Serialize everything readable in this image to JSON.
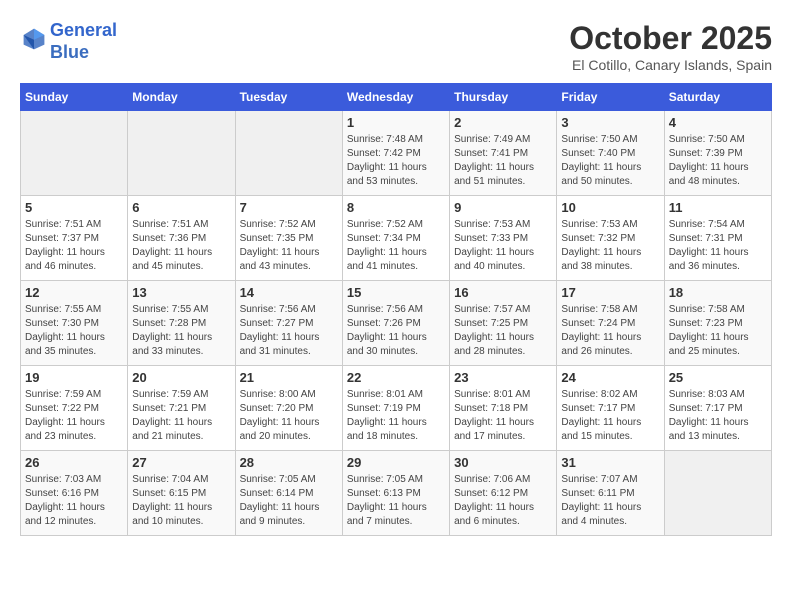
{
  "header": {
    "logo_line1": "General",
    "logo_line2": "Blue",
    "month": "October 2025",
    "location": "El Cotillo, Canary Islands, Spain"
  },
  "weekdays": [
    "Sunday",
    "Monday",
    "Tuesday",
    "Wednesday",
    "Thursday",
    "Friday",
    "Saturday"
  ],
  "weeks": [
    [
      {
        "day": "",
        "sunrise": "",
        "sunset": "",
        "daylight": ""
      },
      {
        "day": "",
        "sunrise": "",
        "sunset": "",
        "daylight": ""
      },
      {
        "day": "",
        "sunrise": "",
        "sunset": "",
        "daylight": ""
      },
      {
        "day": "1",
        "sunrise": "Sunrise: 7:48 AM",
        "sunset": "Sunset: 7:42 PM",
        "daylight": "Daylight: 11 hours and 53 minutes."
      },
      {
        "day": "2",
        "sunrise": "Sunrise: 7:49 AM",
        "sunset": "Sunset: 7:41 PM",
        "daylight": "Daylight: 11 hours and 51 minutes."
      },
      {
        "day": "3",
        "sunrise": "Sunrise: 7:50 AM",
        "sunset": "Sunset: 7:40 PM",
        "daylight": "Daylight: 11 hours and 50 minutes."
      },
      {
        "day": "4",
        "sunrise": "Sunrise: 7:50 AM",
        "sunset": "Sunset: 7:39 PM",
        "daylight": "Daylight: 11 hours and 48 minutes."
      }
    ],
    [
      {
        "day": "5",
        "sunrise": "Sunrise: 7:51 AM",
        "sunset": "Sunset: 7:37 PM",
        "daylight": "Daylight: 11 hours and 46 minutes."
      },
      {
        "day": "6",
        "sunrise": "Sunrise: 7:51 AM",
        "sunset": "Sunset: 7:36 PM",
        "daylight": "Daylight: 11 hours and 45 minutes."
      },
      {
        "day": "7",
        "sunrise": "Sunrise: 7:52 AM",
        "sunset": "Sunset: 7:35 PM",
        "daylight": "Daylight: 11 hours and 43 minutes."
      },
      {
        "day": "8",
        "sunrise": "Sunrise: 7:52 AM",
        "sunset": "Sunset: 7:34 PM",
        "daylight": "Daylight: 11 hours and 41 minutes."
      },
      {
        "day": "9",
        "sunrise": "Sunrise: 7:53 AM",
        "sunset": "Sunset: 7:33 PM",
        "daylight": "Daylight: 11 hours and 40 minutes."
      },
      {
        "day": "10",
        "sunrise": "Sunrise: 7:53 AM",
        "sunset": "Sunset: 7:32 PM",
        "daylight": "Daylight: 11 hours and 38 minutes."
      },
      {
        "day": "11",
        "sunrise": "Sunrise: 7:54 AM",
        "sunset": "Sunset: 7:31 PM",
        "daylight": "Daylight: 11 hours and 36 minutes."
      }
    ],
    [
      {
        "day": "12",
        "sunrise": "Sunrise: 7:55 AM",
        "sunset": "Sunset: 7:30 PM",
        "daylight": "Daylight: 11 hours and 35 minutes."
      },
      {
        "day": "13",
        "sunrise": "Sunrise: 7:55 AM",
        "sunset": "Sunset: 7:28 PM",
        "daylight": "Daylight: 11 hours and 33 minutes."
      },
      {
        "day": "14",
        "sunrise": "Sunrise: 7:56 AM",
        "sunset": "Sunset: 7:27 PM",
        "daylight": "Daylight: 11 hours and 31 minutes."
      },
      {
        "day": "15",
        "sunrise": "Sunrise: 7:56 AM",
        "sunset": "Sunset: 7:26 PM",
        "daylight": "Daylight: 11 hours and 30 minutes."
      },
      {
        "day": "16",
        "sunrise": "Sunrise: 7:57 AM",
        "sunset": "Sunset: 7:25 PM",
        "daylight": "Daylight: 11 hours and 28 minutes."
      },
      {
        "day": "17",
        "sunrise": "Sunrise: 7:58 AM",
        "sunset": "Sunset: 7:24 PM",
        "daylight": "Daylight: 11 hours and 26 minutes."
      },
      {
        "day": "18",
        "sunrise": "Sunrise: 7:58 AM",
        "sunset": "Sunset: 7:23 PM",
        "daylight": "Daylight: 11 hours and 25 minutes."
      }
    ],
    [
      {
        "day": "19",
        "sunrise": "Sunrise: 7:59 AM",
        "sunset": "Sunset: 7:22 PM",
        "daylight": "Daylight: 11 hours and 23 minutes."
      },
      {
        "day": "20",
        "sunrise": "Sunrise: 7:59 AM",
        "sunset": "Sunset: 7:21 PM",
        "daylight": "Daylight: 11 hours and 21 minutes."
      },
      {
        "day": "21",
        "sunrise": "Sunrise: 8:00 AM",
        "sunset": "Sunset: 7:20 PM",
        "daylight": "Daylight: 11 hours and 20 minutes."
      },
      {
        "day": "22",
        "sunrise": "Sunrise: 8:01 AM",
        "sunset": "Sunset: 7:19 PM",
        "daylight": "Daylight: 11 hours and 18 minutes."
      },
      {
        "day": "23",
        "sunrise": "Sunrise: 8:01 AM",
        "sunset": "Sunset: 7:18 PM",
        "daylight": "Daylight: 11 hours and 17 minutes."
      },
      {
        "day": "24",
        "sunrise": "Sunrise: 8:02 AM",
        "sunset": "Sunset: 7:17 PM",
        "daylight": "Daylight: 11 hours and 15 minutes."
      },
      {
        "day": "25",
        "sunrise": "Sunrise: 8:03 AM",
        "sunset": "Sunset: 7:17 PM",
        "daylight": "Daylight: 11 hours and 13 minutes."
      }
    ],
    [
      {
        "day": "26",
        "sunrise": "Sunrise: 7:03 AM",
        "sunset": "Sunset: 6:16 PM",
        "daylight": "Daylight: 11 hours and 12 minutes."
      },
      {
        "day": "27",
        "sunrise": "Sunrise: 7:04 AM",
        "sunset": "Sunset: 6:15 PM",
        "daylight": "Daylight: 11 hours and 10 minutes."
      },
      {
        "day": "28",
        "sunrise": "Sunrise: 7:05 AM",
        "sunset": "Sunset: 6:14 PM",
        "daylight": "Daylight: 11 hours and 9 minutes."
      },
      {
        "day": "29",
        "sunrise": "Sunrise: 7:05 AM",
        "sunset": "Sunset: 6:13 PM",
        "daylight": "Daylight: 11 hours and 7 minutes."
      },
      {
        "day": "30",
        "sunrise": "Sunrise: 7:06 AM",
        "sunset": "Sunset: 6:12 PM",
        "daylight": "Daylight: 11 hours and 6 minutes."
      },
      {
        "day": "31",
        "sunrise": "Sunrise: 7:07 AM",
        "sunset": "Sunset: 6:11 PM",
        "daylight": "Daylight: 11 hours and 4 minutes."
      },
      {
        "day": "",
        "sunrise": "",
        "sunset": "",
        "daylight": ""
      }
    ]
  ]
}
